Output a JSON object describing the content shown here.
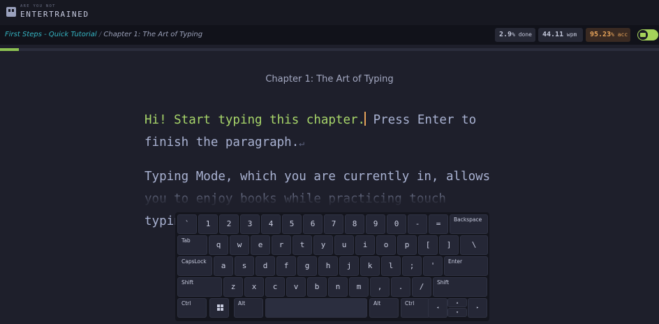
{
  "brand": {
    "tagline": "ARE YOU NOT",
    "name": "ENTERTRAINED"
  },
  "breadcrumb": {
    "course": "First Steps - Quick Tutorial",
    "separator": "/",
    "chapter": "Chapter 1: The Art of Typing"
  },
  "stats": {
    "done": {
      "value": "2.9",
      "unit": "% done"
    },
    "wpm": {
      "value": "44.11",
      "unit": " wpm"
    },
    "acc": {
      "value": "95.23",
      "unit": "% acc"
    }
  },
  "progress": {
    "fraction": 0.029
  },
  "chapter_title": "Chapter 1: The Art of Typing",
  "reader": {
    "p1_typed": "Hi! Start typing this chapter.",
    "p1_rest": " Press Enter to finish the paragraph.",
    "p2": "Typing Mode, which you are currently in, allows you to enjoy books while practicing touch typing.",
    "enter_symbol": "↵"
  },
  "keyboard": {
    "row1": [
      "`",
      "1",
      "2",
      "3",
      "4",
      "5",
      "6",
      "7",
      "8",
      "9",
      "0",
      "-",
      "=",
      "Backspace"
    ],
    "row2": [
      "Tab",
      "q",
      "w",
      "e",
      "r",
      "t",
      "y",
      "u",
      "i",
      "o",
      "p",
      "[",
      "]",
      "\\"
    ],
    "row3": [
      "CapsLock",
      "a",
      "s",
      "d",
      "f",
      "g",
      "h",
      "j",
      "k",
      "l",
      ";",
      "'",
      "Enter"
    ],
    "row4": [
      "Shift",
      "z",
      "x",
      "c",
      "v",
      "b",
      "n",
      "m",
      ",",
      ".",
      "/",
      "Shift"
    ],
    "row5": [
      "Ctrl",
      "Alt",
      "Alt",
      "Ctrl"
    ],
    "arrows": {
      "left": "◂",
      "up": "▴",
      "down": "▾",
      "right": "▸"
    }
  }
}
